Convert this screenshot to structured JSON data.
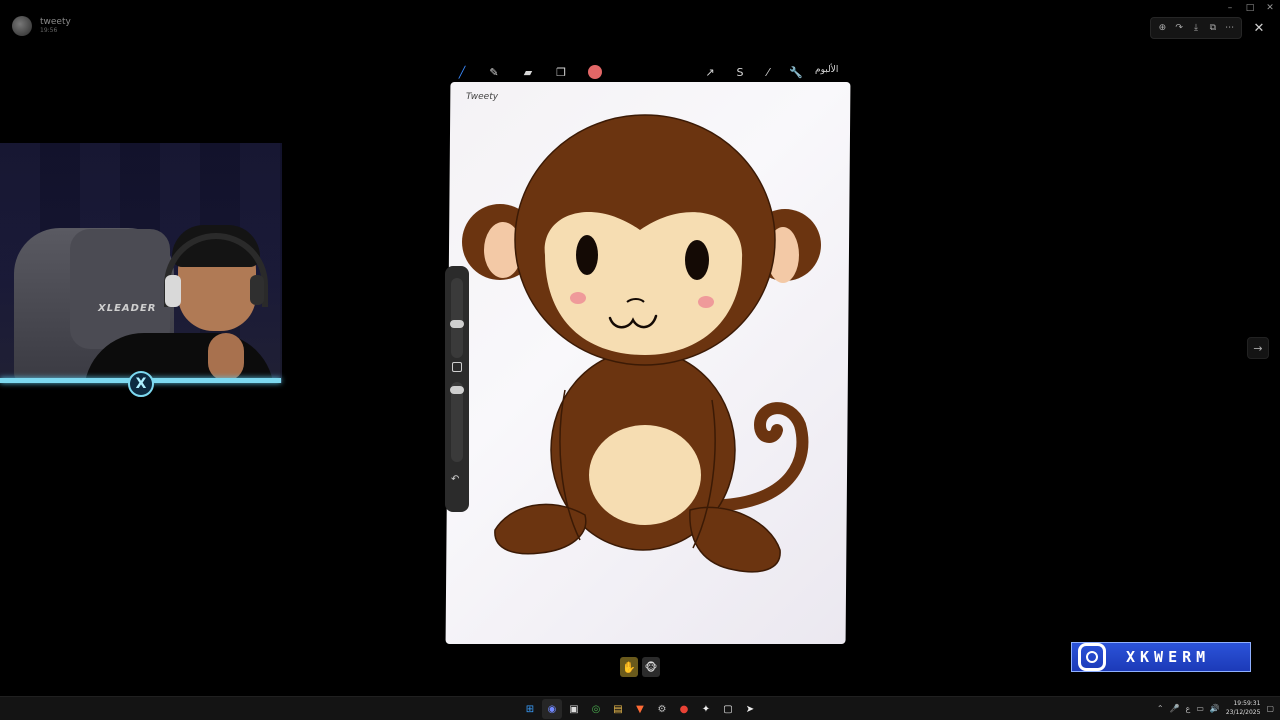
{
  "sender": {
    "name": "tweety",
    "time": "19:56"
  },
  "window_controls": {
    "minimize": "–",
    "maximize": "□",
    "close": "✕"
  },
  "viewer_toolbar": {
    "icons": [
      "zoom-in-icon",
      "forward-icon",
      "download-icon",
      "open-external-icon",
      "more-icon"
    ],
    "glyphs": [
      "⊕",
      "↷",
      "⤓",
      "⧉",
      "⋯"
    ],
    "close": "✕"
  },
  "next_arrow": "→",
  "webcam": {
    "chair_label": "XLEADER",
    "logo": "X",
    "frame_color": "#7dd9f0"
  },
  "drawing_app": {
    "tool_glyphs": {
      "brush": "╱",
      "smudge": "✎",
      "eraser": "▰",
      "layers": "❐"
    },
    "right_glyphs": [
      "↗",
      "S",
      "⁄",
      "🔧"
    ],
    "gallery_label": "الألبوم",
    "color": "#e26767",
    "undo": "↶"
  },
  "monkey": {
    "fur": "#6b3410",
    "face": "#f6ddb2",
    "ear_inner": "#f3c9a6",
    "cheek": "#ef9a9a"
  },
  "signature": "Tweety",
  "reactions": [
    "✋",
    "🐵"
  ],
  "brand": {
    "handle": "XKWERM"
  },
  "taskbar": {
    "apps": [
      "⊞",
      "◉",
      "▣",
      "◎",
      "▤",
      "▼",
      "⚙",
      "●",
      "✦",
      "▢",
      "➤"
    ],
    "tray_icons": [
      "⌃",
      "🎤",
      "ع",
      "▭",
      "🔊"
    ],
    "clock_time": "19:59:31",
    "clock_date": "23/12/2025"
  }
}
